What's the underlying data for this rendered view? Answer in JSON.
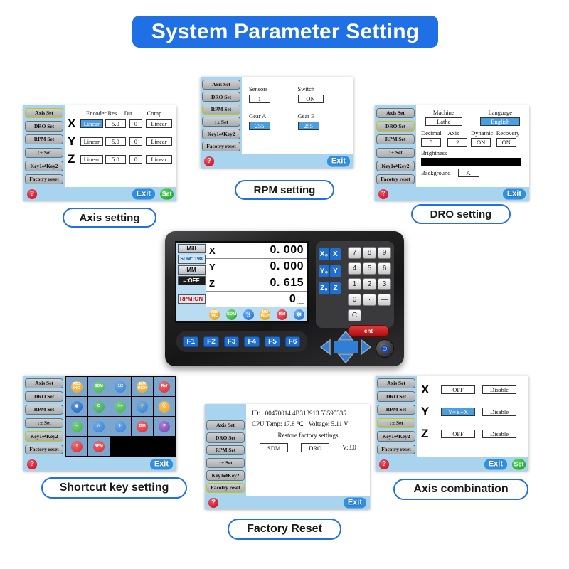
{
  "header": {
    "title": "System Parameter Setting"
  },
  "menu": {
    "items": [
      "Axis Set",
      "DRO Set",
      "RPM  Set",
      "↕±   Set",
      "Key1⇌Key2",
      "Facotry reset"
    ],
    "items_alt": [
      "Axis Set",
      "DRO Set",
      "RPM  Set",
      "↕±   Set",
      "Key1⇌Key2",
      "Factory reset"
    ]
  },
  "common": {
    "exit": "Exit",
    "set": "Set",
    "help": "?"
  },
  "panels": {
    "axis_setting": {
      "caption": "Axis setting",
      "selected_menu": 0,
      "headers": [
        "Encoder Res .",
        "Dir .",
        "Comp ."
      ],
      "rows": [
        {
          "axis": "X",
          "encoder": "Linear",
          "res": "5.0",
          "dir": "0",
          "comp": "Linear",
          "highlight": true
        },
        {
          "axis": "Y",
          "encoder": "Linear",
          "res": "5.0",
          "dir": "0",
          "comp": "Linear",
          "highlight": false
        },
        {
          "axis": "Z",
          "encoder": "Linear",
          "res": "5.0",
          "dir": "0",
          "comp": "Linear",
          "highlight": false
        }
      ]
    },
    "rpm_setting": {
      "caption": "RPM setting",
      "selected_menu": 2,
      "fields": [
        {
          "label": "Sensors",
          "value": "1",
          "highlight": false
        },
        {
          "label": "Switch",
          "value": "ON",
          "highlight": false
        },
        {
          "label": "Gear A",
          "value": "255",
          "highlight": true
        },
        {
          "label": "Gear B",
          "value": "255",
          "highlight": true
        }
      ]
    },
    "dro_setting": {
      "caption": "DRO setting",
      "selected_menu": 1,
      "machine_label": "Machine",
      "machine_value": "Lathe",
      "language_label": "Language",
      "language_value": "English",
      "decimal_label": "Decimal",
      "decimal_value": "5",
      "axis_label": "Axis",
      "axis_value": "2",
      "dynamic_label": "Dynamic",
      "recovery_label": "Recovery",
      "dynamic_value": "ON",
      "recovery_value": "ON",
      "brightness_label": "Brightness",
      "brightness_percent": 100,
      "background_label": "Background",
      "background_value": "A"
    },
    "shortcut_setting": {
      "caption": "Shortcut key setting",
      "selected_menu": 4,
      "icons": [
        {
          "name": "abs-inc-icon",
          "label": "ABS\nINC",
          "color": "#f0a41c"
        },
        {
          "name": "sdm-icon",
          "label": "SDM",
          "color": "#3fb44a"
        },
        {
          "name": "half-icon",
          "label": "1/2",
          "color": "#2f7fd8"
        },
        {
          "name": "mm-inch-icon",
          "label": "MM\nINCH",
          "color": "#f0a41c"
        },
        {
          "name": "ref-icon",
          "label": "Ref",
          "color": "#e0262e"
        },
        {
          "name": "gear-icon",
          "label": "◉",
          "color": "#1b63c4"
        },
        {
          "name": "calc-icon",
          "label": "C",
          "color": "#34a853"
        },
        {
          "name": "datum-icon",
          "label": "⌐+",
          "color": "#3fb44a"
        },
        {
          "name": "bolt-icon",
          "label": "⚡",
          "color": "#2f7fd8"
        },
        {
          "name": "pcd-icon",
          "label": "⦿",
          "color": "#f0a41c"
        },
        {
          "name": "arc-icon",
          "label": "≈",
          "color": "#3fb44a"
        },
        {
          "name": "taper-icon",
          "label": "△",
          "color": "#2f7fd8"
        },
        {
          "name": "tool-icon",
          "label": "⊦",
          "color": "#2f7fd8"
        },
        {
          "name": "dr-icon",
          "label": "D/R",
          "color": "#e0262e"
        },
        {
          "name": "func-icon",
          "label": "F",
          "color": "#7a3fb4"
        },
        {
          "name": "help-icon",
          "label": "?",
          "color": "#e0262e"
        },
        {
          "name": "rpm-icon",
          "label": "RPM",
          "color": "#e0262e"
        }
      ]
    },
    "factory_reset": {
      "caption": "Factory Reset",
      "selected_menu": 5,
      "id_label": "ID:",
      "id_value": "00470014 4B313913 53595335",
      "cpu_temp_label": "CPU Temp:",
      "cpu_temp_value": "17.8 ℃",
      "voltage_label": "Voltage:",
      "voltage_value": "5.11 V",
      "restore_label": "Restore factory settings",
      "btn_sdm": "SDM",
      "btn_dro": "DRO",
      "version": "V:3.0"
    },
    "axis_combination": {
      "caption": "Axis combination",
      "selected_menu": 3,
      "rows": [
        {
          "axis": "X",
          "combo": "OFF",
          "state": "Disable",
          "highlight": false
        },
        {
          "axis": "Y",
          "combo": "Y=Y+X",
          "state": "Disable",
          "highlight": true
        },
        {
          "axis": "Z",
          "combo": "OFF",
          "state": "Disable",
          "highlight": false
        }
      ]
    }
  },
  "device": {
    "lcd": {
      "chips": [
        {
          "name": "mill-mode-chip",
          "text": "Mill",
          "style": "normal"
        },
        {
          "name": "sdm-chip",
          "text": "SDM: 198",
          "style": "blue"
        },
        {
          "name": "unit-chip",
          "text": "MM",
          "style": "normal"
        },
        {
          "name": "filter-chip",
          "text": "≈:OFF",
          "style": "dark"
        },
        {
          "name": "rpm-chip",
          "text": "RPM:ON",
          "style": "rpm"
        }
      ],
      "rows": [
        {
          "axis": "X",
          "value": "0. 000",
          "unit": ""
        },
        {
          "axis": "Y",
          "value": "0. 000",
          "unit": ""
        },
        {
          "axis": "Z",
          "value": "0. 615",
          "unit": ""
        },
        {
          "axis": "",
          "value": "0",
          "unit": "r/min"
        }
      ],
      "toolbar": [
        {
          "name": "abs-inc-icon",
          "label": "ABS\nINC",
          "color": "#f0a41c"
        },
        {
          "name": "sdm-icon",
          "label": "SDM",
          "color": "#3fb44a"
        },
        {
          "name": "half-icon",
          "label": "1/2",
          "color": "#2f7fd8"
        },
        {
          "name": "mm-inch-icon",
          "label": "MM\nINCH",
          "color": "#f0a41c"
        },
        {
          "name": "ref-icon",
          "label": "Ref",
          "color": "#e0262e"
        },
        {
          "name": "gear-icon",
          "label": "◉",
          "color": "#2f7fd8"
        }
      ]
    },
    "axis_keys": [
      "X₀",
      "X",
      "Y₀",
      "Y",
      "Z₀",
      "Z"
    ],
    "numpad": [
      "7",
      "8",
      "9",
      "4",
      "5",
      "6",
      "1",
      "2",
      "3",
      "0",
      "·",
      "—"
    ],
    "clear_key": "C",
    "enter_key": "ent",
    "fkeys": [
      "F1",
      "F2",
      "F3",
      "F4",
      "F5",
      "F6"
    ],
    "power_icon": "⏻"
  },
  "colors": {
    "brand_blue": "#1f6fe5",
    "panel_side": "#a8d4ef",
    "highlight": "#4a9fe0",
    "red": "#cc0018",
    "green": "#149a23"
  }
}
